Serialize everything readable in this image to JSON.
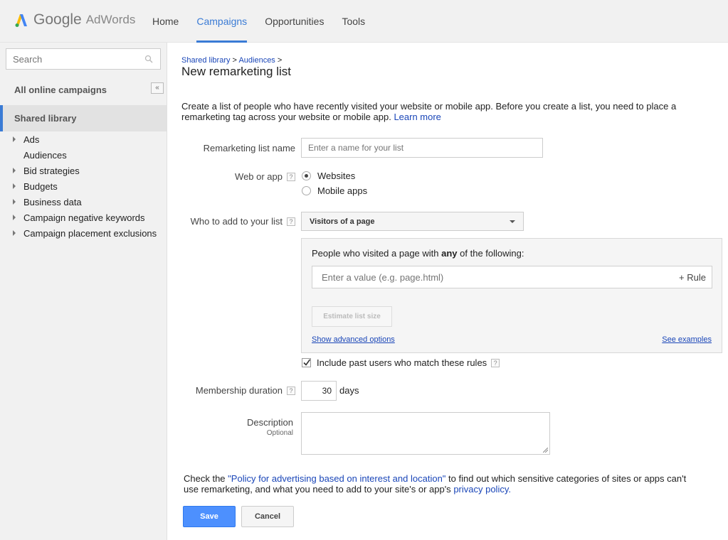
{
  "app": {
    "google": "Google",
    "adwords": "AdWords"
  },
  "nav": [
    "Home",
    "Campaigns",
    "Opportunities",
    "Tools"
  ],
  "nav_active": "Campaigns",
  "sidebar": {
    "search_placeholder": "Search",
    "all_campaigns": "All online campaigns",
    "collapse_label": "«",
    "shared_library": "Shared library",
    "items": [
      {
        "label": "Ads",
        "expandable": true
      },
      {
        "label": "Audiences",
        "expandable": false
      },
      {
        "label": "Bid strategies",
        "expandable": true
      },
      {
        "label": "Budgets",
        "expandable": true
      },
      {
        "label": "Business data",
        "expandable": true
      },
      {
        "label": "Campaign negative keywords",
        "expandable": true
      },
      {
        "label": "Campaign placement exclusions",
        "expandable": true
      }
    ]
  },
  "breadcrumb": {
    "shared": "Shared library",
    "sep": ">",
    "audiences": "Audiences"
  },
  "title": "New remarketing list",
  "intro": {
    "text": "Create a list of people who have recently visited your website or mobile app. Before you create a list, you need to place a remarketing tag across your website or mobile app.",
    "learn_more": "Learn more"
  },
  "form": {
    "list_name_label": "Remarketing list name",
    "list_name_placeholder": "Enter a name for your list",
    "web_or_app_label": "Web or app",
    "help_glyph": "?",
    "radio_websites": "Websites",
    "radio_mobile": "Mobile apps",
    "who_label": "Who to add to your list",
    "who_value": "Visitors of a page",
    "rule_head_pre": "People who visited a page with",
    "rule_head_bold": "any",
    "rule_head_post": "of the following:",
    "rule_placeholder": "Enter a value (e.g. page.html)",
    "rule_add": "+ Rule",
    "estimate": "Estimate list size",
    "advanced": "Show advanced options",
    "examples": "See examples",
    "include_past": "Include past users who match these rules",
    "duration_label": "Membership duration",
    "duration_value": "30",
    "duration_unit": "days",
    "description_label": "Description",
    "description_optional": "Optional"
  },
  "policy": {
    "pre": "Check the",
    "link": "\"Policy for advertising based on interest and location\"",
    "mid": "to find out which sensitive categories of sites or apps can't use remarketing, and what you need to add to your site's or app's",
    "privacy": "privacy policy."
  },
  "buttons": {
    "save": "Save",
    "cancel": "Cancel"
  },
  "colors": {
    "accent": "#3a7bd5",
    "save_button": "#4d90fe",
    "link": "#1a46b8"
  }
}
